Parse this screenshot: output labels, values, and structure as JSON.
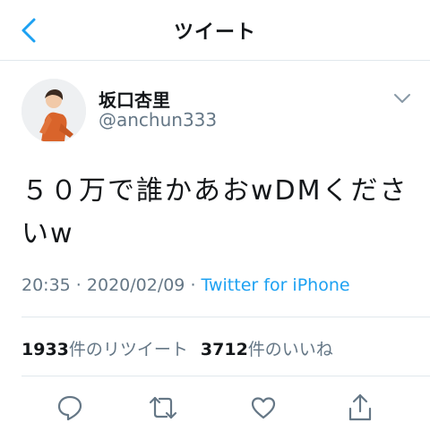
{
  "header": {
    "title": "ツイート"
  },
  "author": {
    "name": "坂口杏里",
    "handle": "@anchun333"
  },
  "tweet": {
    "text_line1": "５０万で誰かあおwDMくださ",
    "text_line2": "いw"
  },
  "meta": {
    "time": "20:35",
    "separator1": " · ",
    "date": "2020/02/09",
    "separator2": " · ",
    "client": "Twitter for iPhone"
  },
  "stats": {
    "retweets_count": "1933",
    "retweets_label": "件のリツイート",
    "likes_count": "3712",
    "likes_label": "件のいいね"
  },
  "icons": {
    "back": "chevron-left-icon",
    "more": "chevron-down-icon",
    "reply": "reply-icon",
    "retweet": "retweet-icon",
    "like": "heart-icon",
    "share": "share-icon"
  },
  "colors": {
    "accent": "#1da1f2",
    "secondary_text": "#657786",
    "primary_text": "#14171a"
  }
}
